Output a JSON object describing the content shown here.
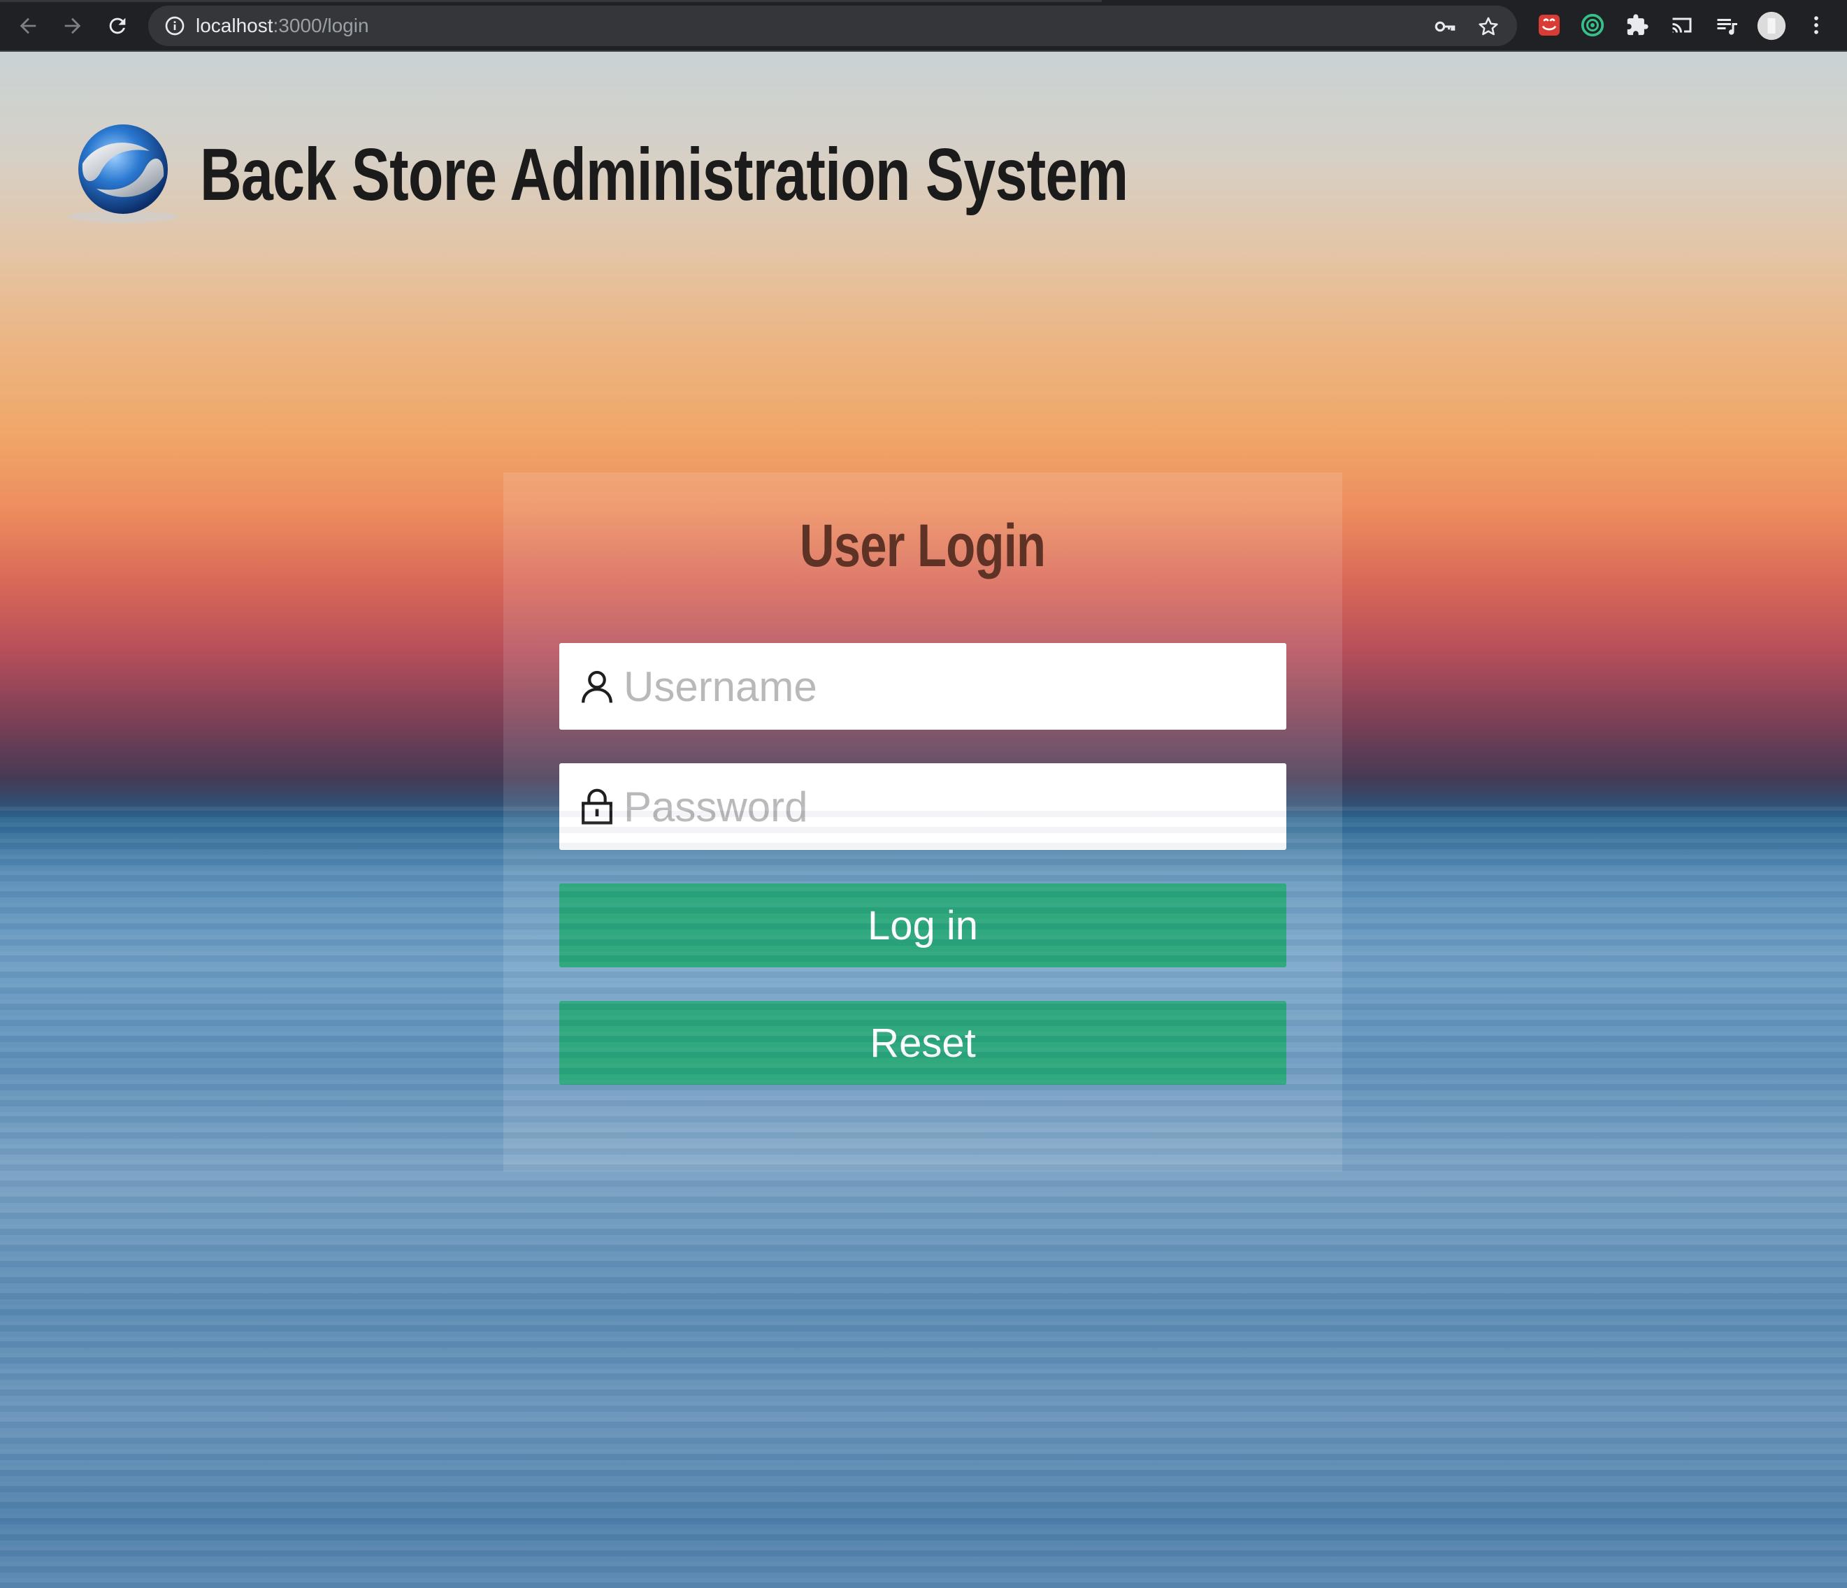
{
  "browser": {
    "url_host": "localhost",
    "url_path": ":3000/login",
    "icons": [
      "back-arrow-icon",
      "forward-arrow-icon",
      "reload-icon",
      "info-icon",
      "key-icon",
      "star-icon",
      "extension-red-icon",
      "extension-green-ring-icon",
      "puzzle-icon",
      "cast-icon",
      "media-queue-icon",
      "profile-avatar-icon",
      "menu-dots-icon"
    ]
  },
  "header": {
    "title": "Back Store Administration System"
  },
  "login": {
    "title": "User Login",
    "username_placeholder": "Username",
    "password_placeholder": "Password",
    "login_label": "Log in",
    "reset_label": "Reset"
  },
  "colors": {
    "button": "#2aa67b",
    "title": "#5e3326",
    "app_title": "#1b1b1b",
    "chrome": "#202124"
  }
}
